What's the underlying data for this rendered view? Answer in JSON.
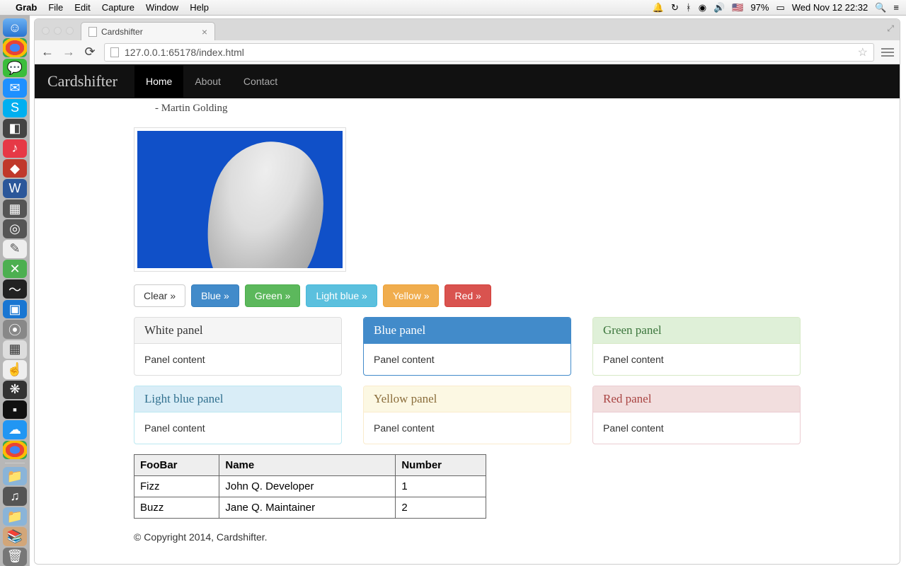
{
  "mac": {
    "app": "Grab",
    "menus": [
      "File",
      "Edit",
      "Capture",
      "Window",
      "Help"
    ],
    "battery": "97%",
    "datetime": "Wed Nov 12  22:32"
  },
  "browser": {
    "tab_title": "Cardshifter",
    "url": "127.0.0.1:65178/index.html"
  },
  "navbar": {
    "brand": "Cardshifter",
    "links": [
      "Home",
      "About",
      "Contact"
    ],
    "active": "Home"
  },
  "quote": {
    "author": "Martin Golding"
  },
  "buttons": [
    {
      "label": "Clear »",
      "cls": "btn-default"
    },
    {
      "label": "Blue »",
      "cls": "btn-primary"
    },
    {
      "label": "Green »",
      "cls": "btn-success"
    },
    {
      "label": "Light blue »",
      "cls": "btn-info"
    },
    {
      "label": "Yellow »",
      "cls": "btn-warning"
    },
    {
      "label": "Red »",
      "cls": "btn-danger"
    }
  ],
  "panels": [
    {
      "title": "White panel",
      "content": "Panel content",
      "cls": "panel-default"
    },
    {
      "title": "Blue panel",
      "content": "Panel content",
      "cls": "panel-primary"
    },
    {
      "title": "Green panel",
      "content": "Panel content",
      "cls": "panel-success"
    },
    {
      "title": "Light blue panel",
      "content": "Panel content",
      "cls": "panel-info"
    },
    {
      "title": "Yellow panel",
      "content": "Panel content",
      "cls": "panel-warning"
    },
    {
      "title": "Red panel",
      "content": "Panel content",
      "cls": "panel-danger"
    }
  ],
  "table": {
    "headers": [
      "FooBar",
      "Name",
      "Number"
    ],
    "rows": [
      [
        "Fizz",
        "John Q. Developer",
        "1"
      ],
      [
        "Buzz",
        "Jane Q. Maintainer",
        "2"
      ]
    ]
  },
  "footer": "© Copyright 2014, Cardshifter."
}
